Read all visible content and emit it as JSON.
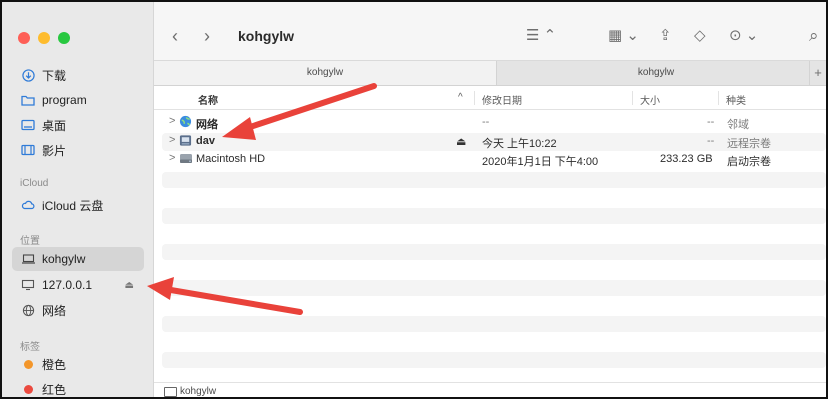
{
  "window": {
    "title": "kohgylw"
  },
  "sidebar": {
    "items_top": [
      {
        "label": "下载",
        "icon": "download-icon"
      },
      {
        "label": "program",
        "icon": "folder-icon"
      },
      {
        "label": "桌面",
        "icon": "desktop-icon"
      },
      {
        "label": "影片",
        "icon": "film-icon"
      }
    ],
    "icloud_section": "iCloud",
    "icloud_items": [
      {
        "label": "iCloud 云盘",
        "icon": "cloud-icon"
      }
    ],
    "location_section": "位置",
    "location_items": [
      {
        "label": "kohgylw",
        "icon": "laptop-icon",
        "selected": true
      },
      {
        "label": "127.0.0.1",
        "icon": "monitor-icon",
        "eject": "⏏"
      },
      {
        "label": "网络",
        "icon": "globe-icon"
      }
    ],
    "tags_section": "标签",
    "tags": [
      {
        "label": "橙色",
        "color": "#f3962a"
      },
      {
        "label": "红色",
        "color": "#eb4a3f"
      }
    ]
  },
  "toolbar": {
    "back": "‹",
    "forward": "›",
    "list_view": "☰ ⌃",
    "group": "▦ ⌄",
    "share": "⇪",
    "tag": "◇",
    "more": "⊙ ⌄",
    "search": "⌕"
  },
  "tabs": [
    {
      "label": "kohgylw",
      "active": true
    },
    {
      "label": "kohgylw",
      "active": false
    }
  ],
  "tab_plus": "+",
  "table": {
    "headers": {
      "name": "名称",
      "sort": "^",
      "modified": "修改日期",
      "size": "大小",
      "kind": "种类"
    },
    "rows": [
      {
        "chev": ">",
        "icon": "network-globe-icon",
        "name": "网络",
        "eject": "",
        "modified": "--",
        "size": "--",
        "kind": "邻域"
      },
      {
        "chev": ">",
        "icon": "server-drive-icon",
        "name": "dav",
        "eject": "⏏",
        "modified": "今天 上午10:22",
        "size": "--",
        "kind": "远程宗卷"
      },
      {
        "chev": ">",
        "icon": "hard-drive-icon",
        "name": "Macintosh HD",
        "eject": "",
        "modified": "2020年1月1日 下午4:00",
        "size": "233.23 GB",
        "kind": "启动宗卷"
      }
    ]
  },
  "pathbar": {
    "label": "kohgylw"
  },
  "annotation_color": "#e9423a"
}
